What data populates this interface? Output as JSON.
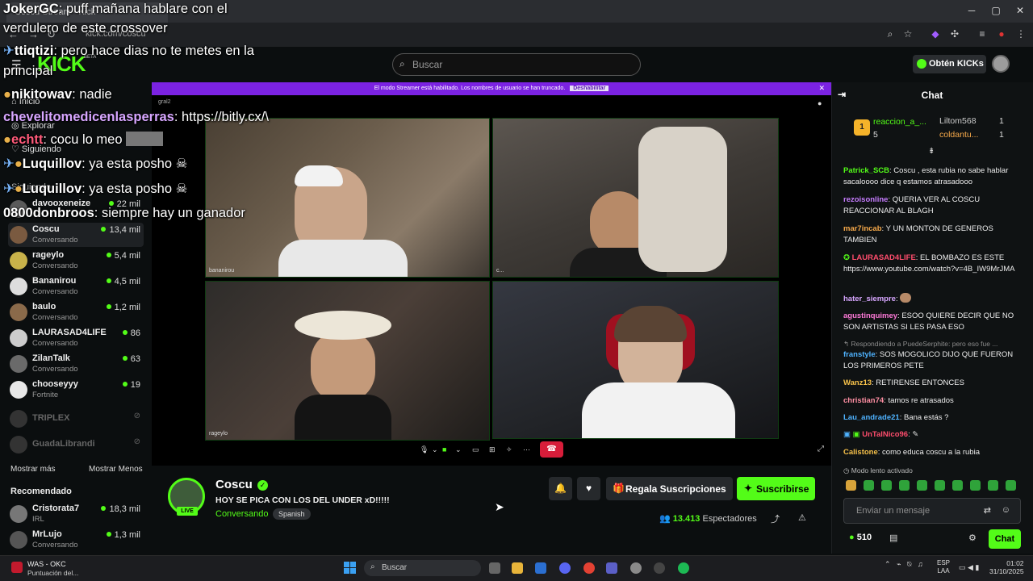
{
  "browser": {
    "tab_title": "Coscu Stream - Kick",
    "url": "kick.com/coscu"
  },
  "header": {
    "search_placeholder": "Buscar",
    "kicks_button": "Obtén KICKs",
    "logo": "KICK",
    "logo_badge": "BETA"
  },
  "sidebar": {
    "nav": [
      "Inicio",
      "Explorar",
      "Siguiendo"
    ],
    "section_following": "Siguiendo",
    "channels": [
      {
        "name": "davooxeneize",
        "category": "",
        "viewers": "22 mil",
        "live": true
      },
      {
        "name": "Coscu",
        "category": "Conversando",
        "viewers": "13,4 mil",
        "live": true,
        "active": true
      },
      {
        "name": "rageylo",
        "category": "Conversando",
        "viewers": "5,4 mil",
        "live": true
      },
      {
        "name": "Bananirou",
        "category": "Conversando",
        "viewers": "4,5 mil",
        "live": true
      },
      {
        "name": "baulo",
        "category": "Conversando",
        "viewers": "1,2 mil",
        "live": true
      },
      {
        "name": "LAURASAD4LIFE",
        "category": "Conversando",
        "viewers": "86",
        "live": true
      },
      {
        "name": "ZilanTalk",
        "category": "Conversando",
        "viewers": "63",
        "live": true
      },
      {
        "name": "chooseyyy",
        "category": "Fortnite",
        "viewers": "19",
        "live": true
      },
      {
        "name": "TRIPLEX",
        "category": "",
        "viewers": "",
        "live": false
      },
      {
        "name": "GuadaLibrandi",
        "category": "",
        "viewers": "",
        "live": false
      }
    ],
    "show_more": "Mostrar más",
    "show_less": "Mostrar Menos",
    "recommended_label": "Recomendado",
    "recommended": [
      {
        "name": "Cristorata7",
        "category": "IRL",
        "viewers": "18,3 mil"
      },
      {
        "name": "MrLujo",
        "category": "Conversando",
        "viewers": "1,3 mil"
      }
    ]
  },
  "overlay_chat": [
    {
      "user": "JokerGC",
      "color": "#ffffff",
      "text": ": puff mañana hablare con el"
    },
    {
      "user": "",
      "color": "#ffffff",
      "text": "verdulero de este crossover"
    },
    {
      "user": "ttiqtizi",
      "color": "#ffffff",
      "text": ": pero hace dias no te metes en la"
    },
    {
      "user": "",
      "color": "#ffffff",
      "text": "principal"
    },
    {
      "user": "nikitowav",
      "color": "#ffffff",
      "text": ": nadie"
    },
    {
      "user": "chevelitomedicenlasperras",
      "color": "#d7a6ff",
      "text": ": https://bitly.cx/\\"
    },
    {
      "user": "echtt",
      "color": "#ff5a7a",
      "text": ": cocu lo meo"
    },
    {
      "user": "Luquillov",
      "color": "#ffffff",
      "text": ": ya esta posho"
    },
    {
      "user": "Luquillov",
      "color": "#ffffff",
      "text": ": ya esta posho"
    },
    {
      "user": "0800donbroos",
      "color": "#ffffff",
      "text": ": siempre hay un ganador"
    }
  ],
  "banner": {
    "text": "El modo Streamer está habilitado. Los nombres de usuario se han truncado.",
    "button": "Deshabilitar"
  },
  "player": {
    "tag": "gral2",
    "cams": [
      "bananirou",
      "c...",
      "rageylo",
      ""
    ]
  },
  "stream": {
    "streamer": "Coscu",
    "title": "HOY SE PICA CON LOS DEL UNDER xD!!!!!",
    "category": "Conversando",
    "language": "Spanish",
    "live_label": "LIVE",
    "gift_button": "Regala Suscripciones",
    "subscribe_button": "Suscribirse",
    "viewers": "13.413",
    "viewers_label": "Espectadores"
  },
  "chat": {
    "title": "Chat",
    "leaderboard": [
      {
        "name": "reaccion_a_...",
        "value": "5"
      },
      {
        "name": "Liltom568",
        "value": "1"
      },
      {
        "name": "coldantu...",
        "value": "1"
      }
    ],
    "messages": [
      {
        "user": "Patrick_SCB",
        "color": "#53fc18",
        "text": ": Coscu , esta rubia no sabe hablar sacaloooo dice q estamos atrasadooo"
      },
      {
        "user": "rezoisonline",
        "color": "#c77dff",
        "text": ": QUERIA VER AL COSCU REACCIONAR AL BLAGH"
      },
      {
        "user": "mar7incab",
        "color": "#f6a94a",
        "text": ": Y UN MONTON DE GENEROS TAMBIEN"
      },
      {
        "user": "LAURASAD4LIFE",
        "color": "#ff4d6d",
        "text": ": EL BOMBAZO ES ESTE https://www.youtube.com/watch?v=4B_IW9MrJMA"
      },
      {
        "user": "hater_siempre",
        "color": "#d7a6ff",
        "text": ":"
      },
      {
        "user": "agustinquimey",
        "color": "#ff7ad9",
        "text": ": ESOO QUIERE DECIR QUE NO SON ARTISTAS SI LES PASA ESO"
      },
      {
        "user": "franstyle",
        "color": "#4fb3ff",
        "text": ": SOS MOGOLICO DIJO QUE FUERON LOS PRIMEROS PETE"
      },
      {
        "user": "Wanz13",
        "color": "#f6c14a",
        "text": ": RETIRENSE ENTONCES"
      },
      {
        "user": "christian74",
        "color": "#ff8fa3",
        "text": ": tamos re atrasados"
      },
      {
        "user": "Lau_andrade21",
        "color": "#4fb3ff",
        "text": ": Bana estás ?"
      },
      {
        "user": "UnTalNico96",
        "color": "#ff4d6d",
        "text": ":"
      },
      {
        "user": "Calistone",
        "color": "#f6c14a",
        "text": ": como educa coscu a la rubia"
      }
    ],
    "reply_note": "Respondiendo a PuedeSerphite: pero eso fue ...",
    "slow_mode": "Modo lento activado",
    "input_placeholder": "Enviar un mensaje",
    "points": "510",
    "send_button": "Chat"
  },
  "taskbar": {
    "app_title": "WAS - OKC",
    "app_subtitle": "Puntuación del...",
    "search_placeholder": "Buscar",
    "lang_1": "ESP",
    "lang_2": "LAA",
    "time": "01:02",
    "date": "31/10/2025"
  }
}
